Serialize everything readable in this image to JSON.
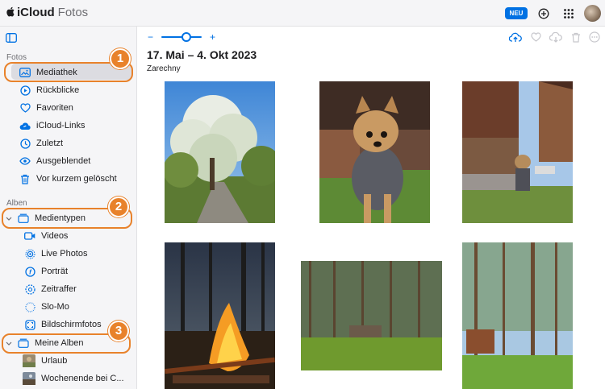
{
  "header": {
    "brand_strong": "iCloud",
    "brand_light": "Fotos",
    "new_badge": "NEU"
  },
  "sidebar": {
    "library_section": "Fotos",
    "library_items": [
      {
        "label": "Mediathek",
        "icon": "photos-library-icon"
      },
      {
        "label": "Rückblicke",
        "icon": "memories-icon"
      },
      {
        "label": "Favoriten",
        "icon": "heart-icon"
      },
      {
        "label": "iCloud-Links",
        "icon": "cloud-link-icon"
      },
      {
        "label": "Zuletzt",
        "icon": "clock-icon"
      },
      {
        "label": "Ausgeblendet",
        "icon": "eye-icon"
      },
      {
        "label": "Vor kurzem gelöscht",
        "icon": "trash-icon"
      }
    ],
    "albums_section": "Alben",
    "media_types": {
      "label": "Medientypen",
      "items": [
        {
          "label": "Videos",
          "icon": "video-icon"
        },
        {
          "label": "Live Photos",
          "icon": "live-photo-icon"
        },
        {
          "label": "Porträt",
          "icon": "portrait-icon"
        },
        {
          "label": "Zeitraffer",
          "icon": "timelapse-icon"
        },
        {
          "label": "Slo-Mo",
          "icon": "slomo-icon"
        },
        {
          "label": "Bildschirmfotos",
          "icon": "screenshot-icon"
        }
      ]
    },
    "my_albums": {
      "label": "Meine Alben",
      "items": [
        {
          "label": "Urlaub"
        },
        {
          "label": "Wochenende bei C..."
        }
      ]
    }
  },
  "callouts": [
    "1",
    "2",
    "3"
  ],
  "toolbar": {
    "zoom_out": "−",
    "zoom_in": "+"
  },
  "main": {
    "date_range": "17. Mai – 4. Okt 2023",
    "location": "Zarechny"
  },
  "colors": {
    "accent": "#0071e3",
    "callout": "#e8822b",
    "sidebar_bg": "#f5f5f7",
    "selected_bg": "#dcdce1"
  }
}
